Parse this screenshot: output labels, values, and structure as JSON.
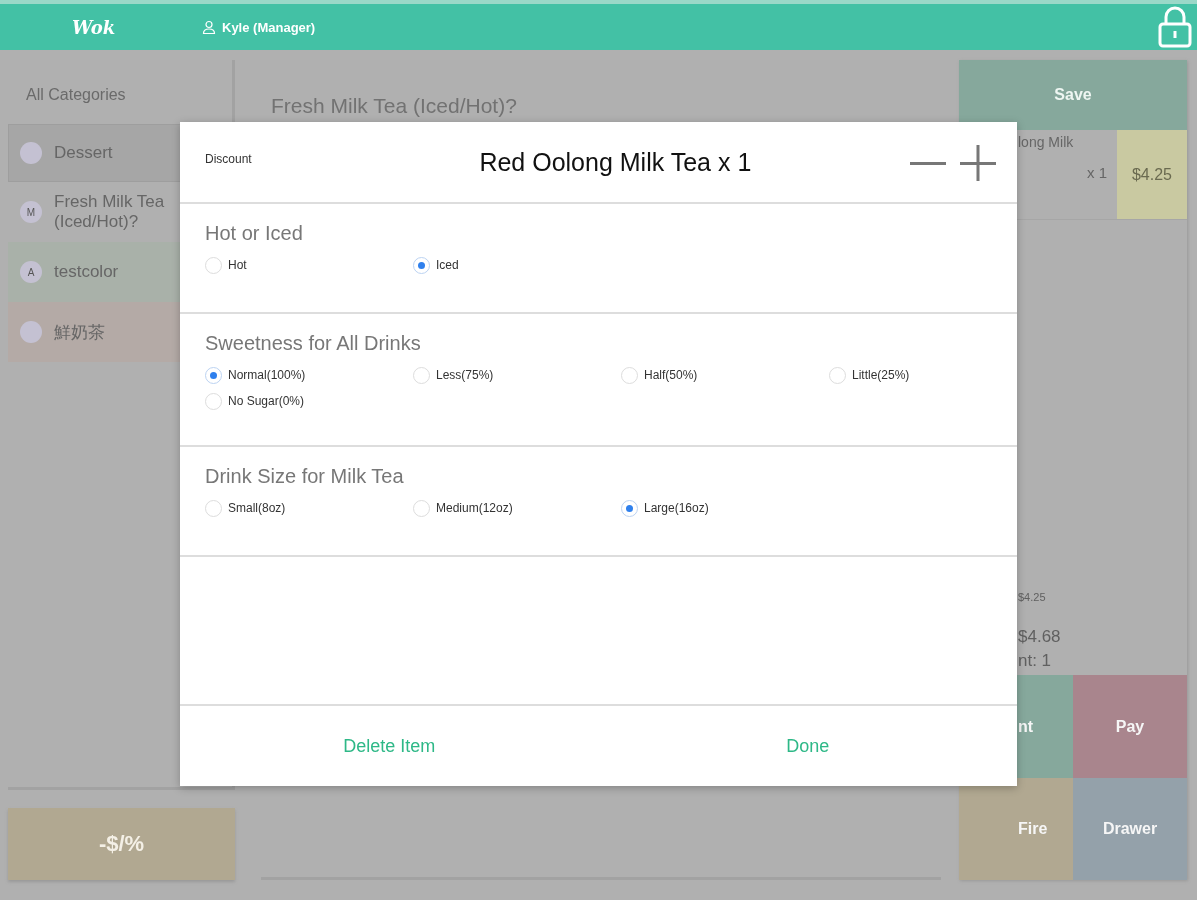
{
  "header": {
    "logo": "Wok",
    "user": "Kyle (Manager)"
  },
  "categories": {
    "title": "All Categories",
    "items": [
      {
        "label": "Dessert",
        "color": "#a6a6a6",
        "selected": true
      },
      {
        "label": "Fresh Milk Tea (Iced/Hot)?",
        "badge": "M",
        "color": "#b0b0b0",
        "selected": false
      },
      {
        "label": "testcolor",
        "badge": "A",
        "color": "#a9b1a9",
        "selected": false
      },
      {
        "label": "鮮奶茶",
        "color": "#b4aaa6",
        "selected": false
      }
    ]
  },
  "discount_button": "-$/%",
  "menu_title": "Fresh Milk Tea (Iced/Hot)?",
  "order": {
    "save": "Save",
    "item_name": "long Milk",
    "item_qty": "x 1",
    "item_price": "$4.25",
    "subtotal": "$4.25",
    "total": "$4.68",
    "count": "nt: 1",
    "actions": [
      {
        "label": "nt",
        "color": "#86a89c"
      },
      {
        "label": "Pay",
        "color": "#a9858d"
      },
      {
        "label": "Fire",
        "color": "#b1a891"
      },
      {
        "label": "Drawer",
        "color": "#94a1aa"
      }
    ]
  },
  "dialog": {
    "discount": "Discount",
    "title": "Red Oolong Milk Tea x 1",
    "groups": [
      {
        "title": "Hot or Iced",
        "options": [
          {
            "label": "Hot",
            "selected": false
          },
          {
            "label": "Iced",
            "selected": true
          }
        ]
      },
      {
        "title": "Sweetness for All Drinks",
        "options": [
          {
            "label": "Normal(100%)",
            "selected": true
          },
          {
            "label": "Less(75%)",
            "selected": false
          },
          {
            "label": "Half(50%)",
            "selected": false
          },
          {
            "label": "Little(25%)",
            "selected": false
          },
          {
            "label": "No Sugar(0%)",
            "selected": false
          }
        ]
      },
      {
        "title": "Drink Size for Milk Tea",
        "options": [
          {
            "label": "Small(8oz)",
            "selected": false
          },
          {
            "label": "Medium(12oz)",
            "selected": false
          },
          {
            "label": "Large(16oz)",
            "selected": true
          }
        ]
      }
    ],
    "buttons": [
      "Delete Item",
      "Done"
    ]
  }
}
